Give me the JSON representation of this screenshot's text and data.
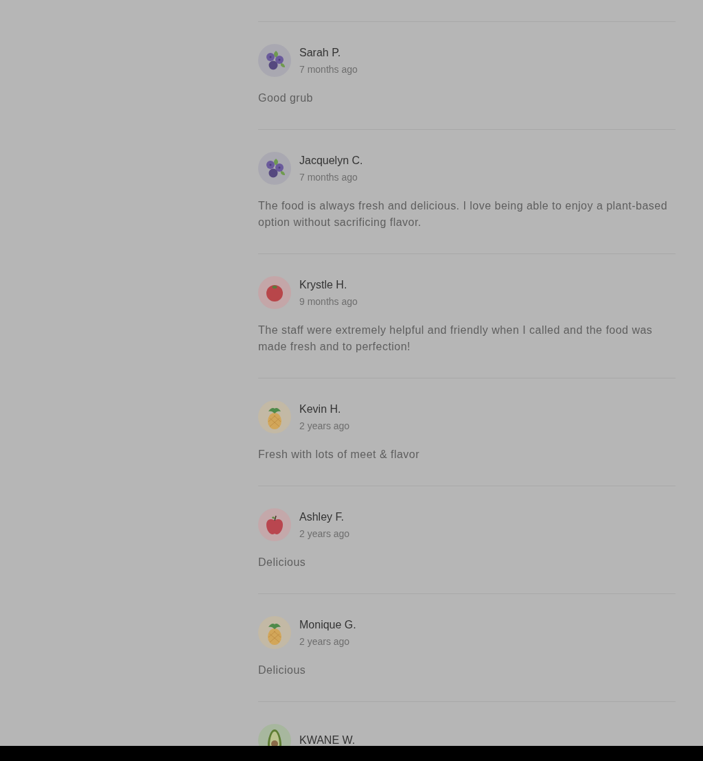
{
  "reviews": [
    {
      "kind": "blueberries",
      "name": "Sarah P.",
      "date": "7 months ago",
      "comment": "Good grub"
    },
    {
      "kind": "blueberries",
      "name": "Jacquelyn C.",
      "date": "7 months ago",
      "comment": "The food is always fresh and delicious. I love being able to enjoy a plant-based option without sacrificing flavor."
    },
    {
      "kind": "tomato",
      "name": "Krystle H.",
      "date": "9 months ago",
      "comment": "The staff were extremely helpful and friendly when I called and the food was made fresh and to perfection!"
    },
    {
      "kind": "pineapple",
      "name": "Kevin H.",
      "date": "2 years ago",
      "comment": "Fresh with lots of meet & flavor"
    },
    {
      "kind": "apple",
      "name": "Ashley F.",
      "date": "2 years ago",
      "comment": "Delicious"
    },
    {
      "kind": "pineapple",
      "name": "Monique G.",
      "date": "2 years ago",
      "comment": "Delicious"
    },
    {
      "kind": "avocado",
      "name": "KWANE W."
    }
  ]
}
